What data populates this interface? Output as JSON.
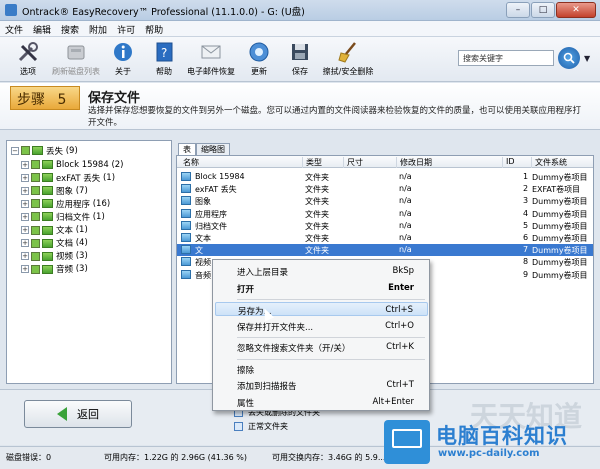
{
  "window": {
    "title": "Ontrack® EasyRecovery™ Professional (11.1.0.0) - G: (U盘)",
    "btn_min": "–",
    "btn_max": "□",
    "btn_close": "✕"
  },
  "menu": [
    "文件",
    "编辑",
    "搜索",
    "附加",
    "许可",
    "帮助"
  ],
  "toolbar": [
    {
      "label": "选项",
      "icon": "tools-icon",
      "enabled": true
    },
    {
      "label": "刷新磁盘列表",
      "icon": "disk-icon",
      "enabled": false
    },
    {
      "label": "关于",
      "icon": "info-icon",
      "enabled": true
    },
    {
      "label": "帮助",
      "icon": "help-book-icon",
      "enabled": true
    },
    {
      "label": "电子邮件恢复",
      "icon": "envelope-icon",
      "enabled": true
    },
    {
      "label": "更新",
      "icon": "update-icon",
      "enabled": true
    },
    {
      "label": "保存",
      "icon": "save-icon",
      "enabled": true
    },
    {
      "label": "擦拭/安全删除",
      "icon": "broom-icon",
      "enabled": true
    }
  ],
  "search": {
    "placeholder": "搜索关键字",
    "dropdown": "▼"
  },
  "step": {
    "label": "步骤",
    "number": "5",
    "title": "保存文件",
    "description": "选择并保存您想要恢复的文件到另外一个磁盘。您可以通过内置的文件阅读器来检验恢复的文件的质量，也可以使用关联应用程序打开文件。"
  },
  "tree": {
    "root": {
      "label": "丢失",
      "count": "(9)"
    },
    "children": [
      {
        "label": "Block 15984",
        "count": "(2)"
      },
      {
        "label": "exFAT 丢失",
        "count": "(1)"
      },
      {
        "label": "图象",
        "count": "(7)"
      },
      {
        "label": "应用程序",
        "count": "(16)"
      },
      {
        "label": "归档文件",
        "count": "(1)"
      },
      {
        "label": "文本",
        "count": "(1)"
      },
      {
        "label": "文档",
        "count": "(4)"
      },
      {
        "label": "视频",
        "count": "(3)"
      },
      {
        "label": "音频",
        "count": "(3)"
      }
    ]
  },
  "tabs": [
    "表",
    "缩略图"
  ],
  "columns": [
    "名称",
    "类型",
    "尺寸",
    "修改日期",
    "ID",
    "文件系统"
  ],
  "rows": [
    {
      "name": "Block 15984",
      "type": "文件夹",
      "size": "",
      "date": "n/a",
      "id": "1",
      "fs": "Dummy卷项目"
    },
    {
      "name": "exFAT 丢失",
      "type": "文件夹",
      "size": "",
      "date": "n/a",
      "id": "2",
      "fs": "EXFAT卷项目"
    },
    {
      "name": "图象",
      "type": "文件夹",
      "size": "",
      "date": "n/a",
      "id": "3",
      "fs": "Dummy卷项目"
    },
    {
      "name": "应用程序",
      "type": "文件夹",
      "size": "",
      "date": "n/a",
      "id": "4",
      "fs": "Dummy卷项目"
    },
    {
      "name": "归档文件",
      "type": "文件夹",
      "size": "",
      "date": "n/a",
      "id": "5",
      "fs": "Dummy卷项目"
    },
    {
      "name": "文本",
      "type": "文件夹",
      "size": "",
      "date": "n/a",
      "id": "6",
      "fs": "Dummy卷项目"
    },
    {
      "name": "文",
      "type": "文件夹",
      "size": "",
      "date": "n/a",
      "id": "7",
      "fs": "Dummy卷项目",
      "selected": true
    },
    {
      "name": "视频",
      "type": "",
      "size": "",
      "date": "",
      "id": "8",
      "fs": "Dummy卷项目"
    },
    {
      "name": "音频",
      "type": "",
      "size": "",
      "date": "",
      "id": "9",
      "fs": "Dummy卷项目"
    }
  ],
  "context_menu": [
    {
      "label": "进入上层目录",
      "key": "BkSp"
    },
    {
      "label": "打开",
      "key": "Enter",
      "bold": true
    },
    {
      "sep": true
    },
    {
      "label": "另存为...",
      "key": "Ctrl+S",
      "highlight": true
    },
    {
      "label": "保存并打开文件夹...",
      "key": "Ctrl+O"
    },
    {
      "sep": true
    },
    {
      "label": "忽略文件搜索文件夹（开/关）",
      "key": "Ctrl+K"
    },
    {
      "sep": true
    },
    {
      "label": "擦除",
      "key": ""
    },
    {
      "label": "添加到扫描报告",
      "key": "Ctrl+T"
    },
    {
      "label": "属性",
      "key": "Alt+Enter"
    }
  ],
  "back_button": "返回",
  "legend": [
    "丢失或删除的文件夹",
    "正常文件夹"
  ],
  "status": {
    "disk_error": "磁盘错误：0",
    "mem": "可用内存：1.22G 的 2.96G (41.36 %)",
    "swap": "可用交换内存：3.46G 的 5.9..."
  },
  "watermark": {
    "title": "电脑百科知识",
    "url": "www.pc-daily.com",
    "bg": "天天知道"
  }
}
